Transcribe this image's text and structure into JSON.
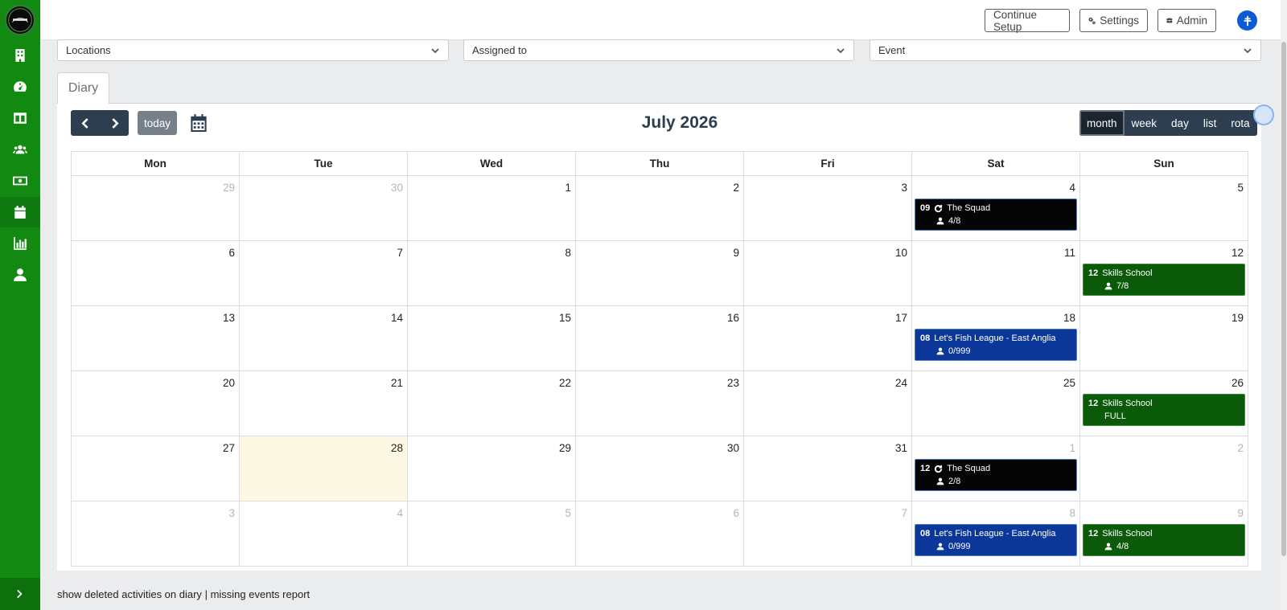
{
  "topbar": {
    "continue_setup": "Continue Setup",
    "settings": "Settings",
    "admin": "Admin"
  },
  "filters": {
    "locations": "Locations",
    "assigned_to": "Assigned to",
    "event": "Event"
  },
  "tab": {
    "label": "Diary"
  },
  "calendar": {
    "title": "July 2026",
    "today_label": "today",
    "views": [
      "month",
      "week",
      "day",
      "list",
      "rota"
    ],
    "active_view": "month",
    "weekdays": [
      "Mon",
      "Tue",
      "Wed",
      "Thu",
      "Fri",
      "Sat",
      "Sun"
    ],
    "weeks": [
      {
        "days": [
          "29",
          "30",
          "1",
          "2",
          "3",
          "4",
          "5"
        ]
      },
      {
        "days": [
          "6",
          "7",
          "8",
          "9",
          "10",
          "11",
          "12"
        ]
      },
      {
        "days": [
          "13",
          "14",
          "15",
          "16",
          "17",
          "18",
          "19"
        ]
      },
      {
        "days": [
          "20",
          "21",
          "22",
          "23",
          "24",
          "25",
          "26"
        ]
      },
      {
        "days": [
          "27",
          "28",
          "29",
          "30",
          "31",
          "1",
          "2"
        ]
      },
      {
        "days": [
          "3",
          "4",
          "5",
          "6",
          "7",
          "8",
          "9"
        ]
      }
    ],
    "events": [
      {
        "time": "09",
        "title": "The Squad",
        "capacity": "4/8",
        "color": "#050505",
        "recurring": true
      },
      {
        "time": "12",
        "title": "Skills School",
        "capacity": "7/8",
        "color": "#0a5a0a",
        "recurring": false
      },
      {
        "time": "08",
        "title": "Let's Fish League - East Anglia",
        "capacity": "0/999",
        "color": "#0b3898",
        "recurring": false
      },
      {
        "time": "12",
        "title": "Skills School",
        "capacity": "FULL",
        "color": "#0a5a0a",
        "recurring": false
      },
      {
        "time": "12",
        "title": "The Squad",
        "capacity": "2/8",
        "color": "#050505",
        "recurring": true
      },
      {
        "time": "08",
        "title": "Let's Fish League - East Anglia",
        "capacity": "0/999",
        "color": "#0b3898",
        "recurring": false
      },
      {
        "time": "12",
        "title": "Skills School",
        "capacity": "4/8",
        "color": "#0a5a0a",
        "recurring": false
      }
    ]
  },
  "footer": {
    "deleted_link": "show deleted activities on diary",
    "separator": "|",
    "missing_link": "missing events report"
  },
  "icons": {
    "sidebar": [
      "building-icon",
      "dashboard-icon",
      "table-icon",
      "users-icon",
      "money-icon",
      "calendar-icon",
      "chart-icon",
      "user-icon"
    ]
  },
  "colors": {
    "sidebar": "#128a12",
    "calendar_dark": "#2c3e50",
    "today_bg": "#fcf8e3",
    "avatar": "#0b5bd3"
  }
}
